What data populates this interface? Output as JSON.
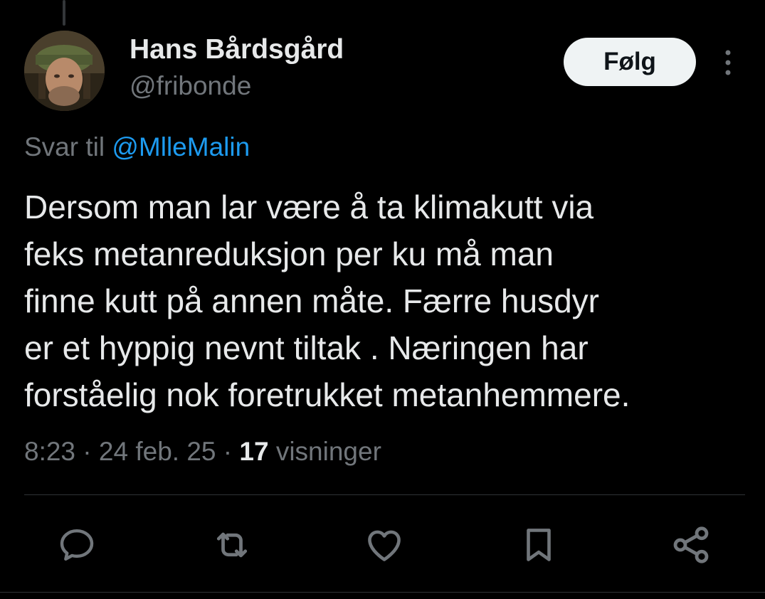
{
  "author": {
    "display_name": "Hans Bårdsgård",
    "handle": "@fribonde"
  },
  "follow_button": {
    "label": "Følg"
  },
  "reply_context": {
    "prefix": "Svar til ",
    "mention": "@MlleMalin"
  },
  "tweet": {
    "lines": [
      "Dersom man lar være å ta klimakutt via",
      "feks metanreduksjon per ku må man",
      "finne kutt på annen måte. Færre husdyr",
      "er et hyppig nevnt tiltak . Næringen har",
      "forståelig nok foretrukket metanhemmere."
    ]
  },
  "meta": {
    "time": "8:23",
    "date": "24 feb. 25",
    "views_count": "17",
    "views_label": "visninger",
    "separator": " · "
  },
  "actions": [
    {
      "icon": "reply-icon"
    },
    {
      "icon": "retweet-icon"
    },
    {
      "icon": "like-icon"
    },
    {
      "icon": "bookmark-icon"
    },
    {
      "icon": "share-icon"
    }
  ],
  "colors": {
    "background": "#000000",
    "text_primary": "#e7e9ea",
    "text_secondary": "#71767b",
    "link": "#1d9bf0",
    "follow_button_bg": "#eff3f4",
    "divider": "#2f3336"
  }
}
